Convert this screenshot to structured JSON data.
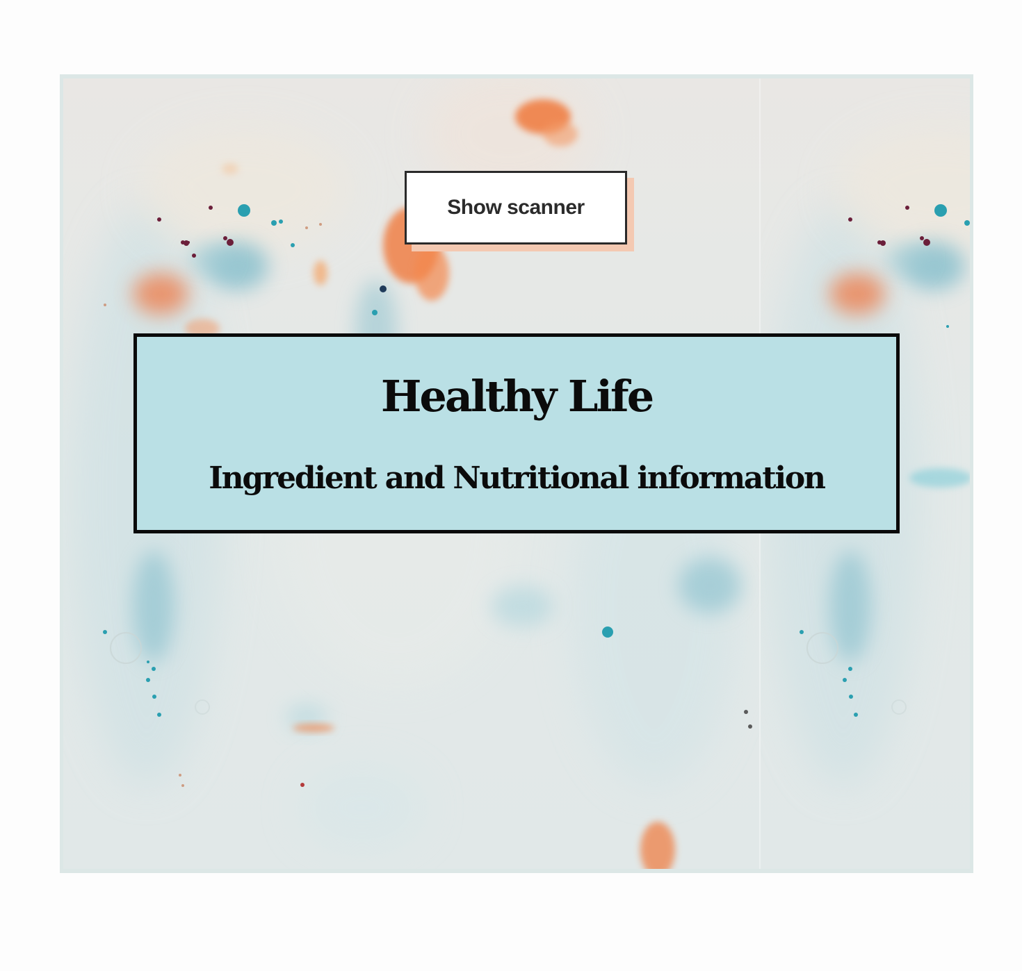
{
  "scanner": {
    "show_label": "Show scanner"
  },
  "hero": {
    "title": "Healthy Life",
    "subtitle": "Ingredient and Nutritional information"
  },
  "colors": {
    "page_background": "#fdfdfd",
    "frame_border": "#dce7e6",
    "hero_background": "#bae0e5",
    "hero_border": "#0a0a0a",
    "button_shadow": "#f4c9b2",
    "paint_orange": "#f07a3c",
    "paint_teal": "#2a9fb0",
    "paint_maroon": "#6b1f3a"
  },
  "background": {
    "description_icon": "watercolor-marble-texture"
  }
}
